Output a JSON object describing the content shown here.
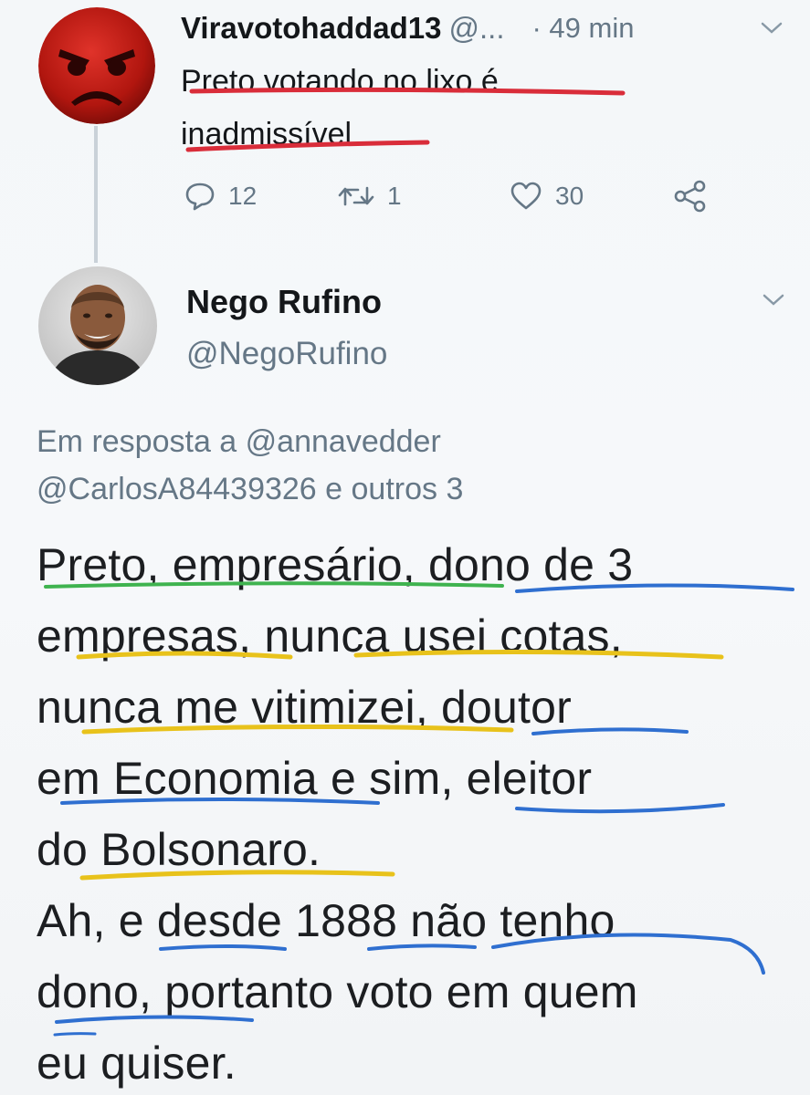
{
  "tweet_parent": {
    "display_name": "Viravotohaddad13",
    "handle": "@...",
    "time": "· 49 min",
    "text_line1": "Preto votando no lixo é",
    "text_line2": "inadmissível",
    "actions": {
      "reply_count": "12",
      "retweet_count": "1",
      "like_count": "30"
    }
  },
  "tweet_reply": {
    "display_name": "Nego Rufino",
    "handle": "@NegoRufino",
    "reply_prefix": "Em resposta a",
    "reply_mention_1": "@annavedder",
    "reply_mention_2": "@CarlosA84439326",
    "reply_suffix": "e outros 3",
    "body_lines": [
      "Preto, empresário, dono de 3",
      "empresas, nunca usei cotas,",
      "nunca me vitimizei, doutor",
      "em Economia e sim, eleitor",
      "do Bolsonaro.",
      "Ah, e desde 1888 não tenho",
      "dono, portanto voto em quem",
      "eu quiser."
    ]
  },
  "icons": [
    "angry-face-avatar",
    "user-photo-avatar",
    "reply-icon",
    "retweet-icon",
    "like-icon",
    "share-icon",
    "chevron-down-icon"
  ],
  "colors": {
    "text": "#14171a",
    "muted": "#657786",
    "underline_red": "#d92d3a",
    "underline_blue": "#2f6fd0",
    "underline_yellow": "#e8c21b",
    "underline_green": "#3fb34f"
  }
}
